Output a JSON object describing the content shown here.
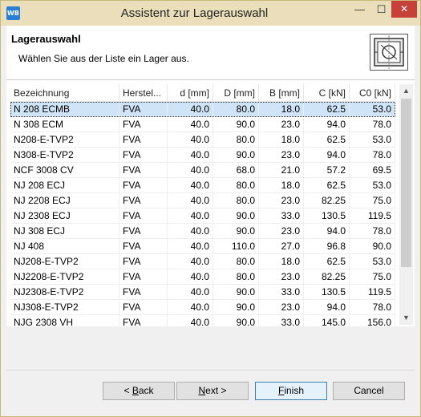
{
  "window": {
    "app_icon_text": "WB",
    "title": "Assistent zur Lagerauswahl",
    "minimize_glyph": "—",
    "maximize_glyph": "☐",
    "close_glyph": "✕"
  },
  "header": {
    "title": "Lagerauswahl",
    "description": "Wählen Sie aus der Liste ein Lager aus.",
    "image_icon": "bearing-icon"
  },
  "table": {
    "columns": [
      "Bezeichnung",
      "Herstel...",
      "d [mm]",
      "D [mm]",
      "B [mm]",
      "C [kN]",
      "C0 [kN]"
    ],
    "selected_row": 0,
    "rows": [
      [
        "N 208 ECMB",
        "FVA",
        "40.0",
        "80.0",
        "18.0",
        "62.5",
        "53.0"
      ],
      [
        "N 308 ECM",
        "FVA",
        "40.0",
        "90.0",
        "23.0",
        "94.0",
        "78.0"
      ],
      [
        "N208-E-TVP2",
        "FVA",
        "40.0",
        "80.0",
        "18.0",
        "62.5",
        "53.0"
      ],
      [
        "N308-E-TVP2",
        "FVA",
        "40.0",
        "90.0",
        "23.0",
        "94.0",
        "78.0"
      ],
      [
        "NCF 3008 CV",
        "FVA",
        "40.0",
        "68.0",
        "21.0",
        "57.2",
        "69.5"
      ],
      [
        "NJ 208 ECJ",
        "FVA",
        "40.0",
        "80.0",
        "18.0",
        "62.5",
        "53.0"
      ],
      [
        "NJ 2208 ECJ",
        "FVA",
        "40.0",
        "80.0",
        "23.0",
        "82.25",
        "75.0"
      ],
      [
        "NJ 2308 ECJ",
        "FVA",
        "40.0",
        "90.0",
        "33.0",
        "130.5",
        "119.5"
      ],
      [
        "NJ 308 ECJ",
        "FVA",
        "40.0",
        "90.0",
        "23.0",
        "94.0",
        "78.0"
      ],
      [
        "NJ 408",
        "FVA",
        "40.0",
        "110.0",
        "27.0",
        "96.8",
        "90.0"
      ],
      [
        "NJ208-E-TVP2",
        "FVA",
        "40.0",
        "80.0",
        "18.0",
        "62.5",
        "53.0"
      ],
      [
        "NJ2208-E-TVP2",
        "FVA",
        "40.0",
        "80.0",
        "23.0",
        "82.25",
        "75.0"
      ],
      [
        "NJ2308-E-TVP2",
        "FVA",
        "40.0",
        "90.0",
        "33.0",
        "130.5",
        "119.5"
      ],
      [
        "NJ308-E-TVP2",
        "FVA",
        "40.0",
        "90.0",
        "23.0",
        "94.0",
        "78.0"
      ],
      [
        "NJG 2308 VH",
        "FVA",
        "40.0",
        "90.0",
        "33.0",
        "145.0",
        "156.0"
      ]
    ]
  },
  "scrollbar": {
    "up_glyph": "▲",
    "down_glyph": "▼"
  },
  "buttons": {
    "back_accel": "B",
    "back_prefix": "< ",
    "back_rest": "ack",
    "next_accel": "N",
    "next_rest": "ext >",
    "finish_accel": "F",
    "finish_rest": "inish",
    "cancel": "Cancel"
  },
  "colors": {
    "titlebar": "#eadfba",
    "selection": "#cfe4f7",
    "close_button": "#c7413b"
  }
}
